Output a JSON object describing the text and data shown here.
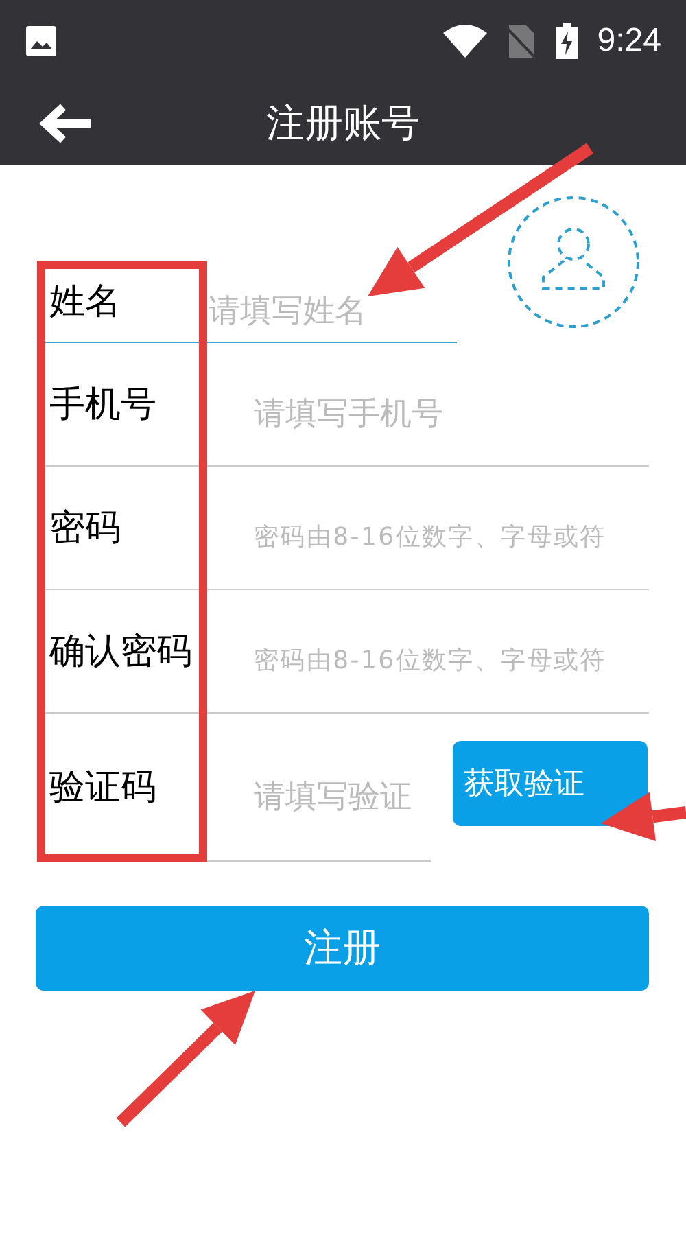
{
  "status_bar": {
    "time": "9:24"
  },
  "toolbar": {
    "title": "注册账号"
  },
  "name_row": {
    "label": "姓名",
    "placeholder": "请填写姓名",
    "focused": true
  },
  "fields": [
    {
      "label": "手机号",
      "placeholder": "请填写手机号",
      "kind": "text",
      "focused": false
    },
    {
      "label": "密码",
      "placeholder": "密码由8-16位数字、字母或符",
      "kind": "password",
      "focused": false
    },
    {
      "label": "确认密码",
      "placeholder": "密码由8-16位数字、字母或符",
      "kind": "password",
      "focused": false
    },
    {
      "label": "验证码",
      "placeholder": "请填写验证",
      "kind": "code",
      "focused": false,
      "button": "获取验证"
    }
  ],
  "submit_button": {
    "label": "注册"
  }
}
